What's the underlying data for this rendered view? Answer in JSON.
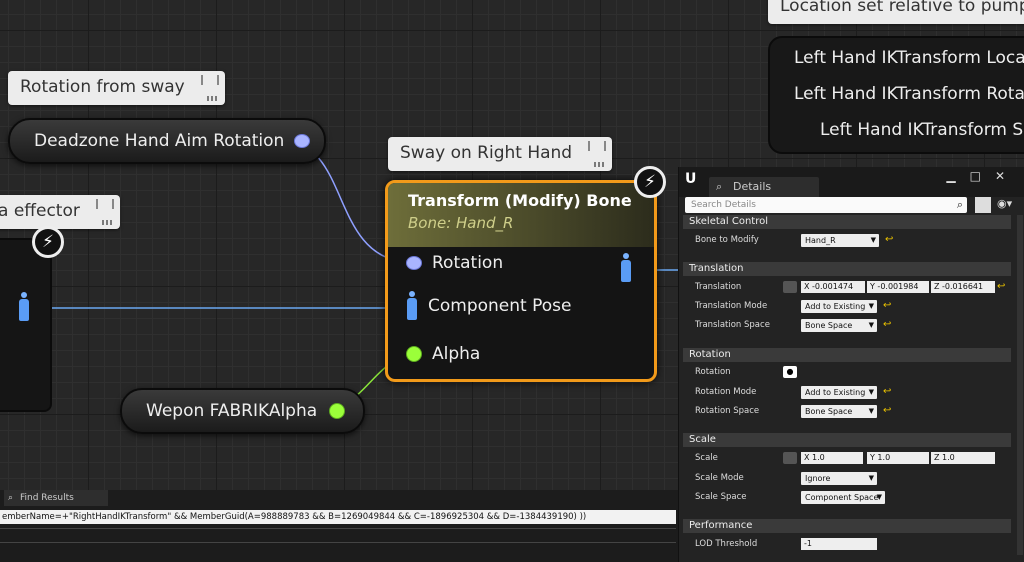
{
  "comments": {
    "rotation_from_sway": "Rotation from sway",
    "effector": "a effector",
    "sway_on_right_hand": "Sway on Right Hand",
    "location_set": "Location set relative to pump b"
  },
  "nodes": {
    "deadzone": "Deadzone Hand Aim Rotation",
    "wepon_alpha": "Wepon FABRIKAlpha",
    "right_node_lines": [
      "Left Hand IKTransform Locatio",
      "Left Hand IKTransform Rotatio",
      "Left Hand IKTransform Sca"
    ],
    "transform": {
      "title": "Transform (Modify) Bone",
      "subtitle": "Bone: Hand_R",
      "pins": [
        "Rotation",
        "Component Pose",
        "Alpha"
      ]
    }
  },
  "details": {
    "tab_label": "Details",
    "search_placeholder": "Search Details",
    "sections": {
      "skeletal": "Skeletal Control",
      "translation": "Translation",
      "rotation": "Rotation",
      "scale": "Scale",
      "performance": "Performance"
    },
    "bone_to_modify": {
      "label": "Bone to Modify",
      "value": "Hand_R"
    },
    "translation": {
      "label": "Translation",
      "x": "X  -0.001474",
      "y": "Y  -0.001984",
      "z": "Z  -0.016641",
      "mode_label": "Translation Mode",
      "mode_value": "Add to Existing",
      "space_label": "Translation Space",
      "space_value": "Bone Space"
    },
    "rotation": {
      "label": "Rotation",
      "mode_label": "Rotation Mode",
      "mode_value": "Add to Existing",
      "space_label": "Rotation Space",
      "space_value": "Bone Space"
    },
    "scale": {
      "label": "Scale",
      "x": "X  1.0",
      "y": "Y  1.0",
      "z": "Z  1.0",
      "mode_label": "Scale Mode",
      "mode_value": "Ignore",
      "space_label": "Scale Space",
      "space_value": "Component Space"
    },
    "lod": {
      "label": "LOD Threshold",
      "value": "-1"
    }
  },
  "find_results": {
    "tab_label": "Find Results",
    "query": "emberName=+\"RightHandIKTransform\" && MemberGuid(A=988889783 && B=1269049844 && C=-1896925304 && D=-1384439190) ))"
  },
  "colors": {
    "accent": "#f29a1a",
    "rotation_pin": "#a9b4ff",
    "alpha_pin": "#9bff3a"
  }
}
